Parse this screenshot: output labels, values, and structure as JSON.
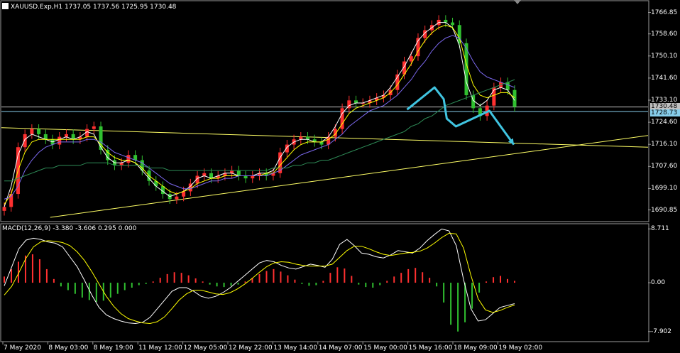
{
  "header": {
    "main_title": "XAUUSD.Exp,H1  1737.05 1737.56 1725.95 1730.48",
    "macd_title": "MACD(12,26,9) -3.380 -3.606 0.295 0.000"
  },
  "chart_data": [
    {
      "type": "candlestick",
      "title": "XAUUSD.Exp,H1  1737.05 1737.56 1725.95 1730.48",
      "symbol": "XAUUSD.Exp",
      "timeframe": "H1",
      "ohlc_last": {
        "open": 1737.05,
        "high": 1737.56,
        "low": 1725.95,
        "close": 1730.48
      },
      "ylim": [
        1688.0,
        1770.0
      ],
      "y_ticks": [
        "1766.85",
        "1758.60",
        "1750.10",
        "1741.60",
        "1733.10",
        "1724.60",
        "1716.10",
        "1707.60",
        "1699.10",
        "1690.85"
      ],
      "x_ticks": [
        "7 May 2020",
        "8 May 03:00",
        "8 May 19:00",
        "11 May 12:00",
        "12 May 05:00",
        "12 May 22:00",
        "13 May 14:00",
        "14 May 07:00",
        "15 May 00:00",
        "15 May 16:00",
        "18 May 09:00",
        "19 May 02:00"
      ],
      "price_tags": [
        {
          "value": "1730.48",
          "color": "#c0c0c0"
        },
        {
          "value": "1728.73",
          "color": "#87ceeb"
        }
      ],
      "horizontal_levels": [
        1730.48,
        1728.73
      ],
      "close_path": [
        1692,
        1697,
        1715,
        1720,
        1722,
        1720,
        1718,
        1716,
        1719,
        1720,
        1718,
        1719,
        1722,
        1723,
        1714,
        1710,
        1708,
        1709,
        1712,
        1710,
        1706,
        1702,
        1700,
        1697,
        1695,
        1696,
        1698,
        1701,
        1704,
        1705,
        1703,
        1704,
        1705,
        1706,
        1704,
        1703,
        1704,
        1705,
        1704,
        1705,
        1713,
        1716,
        1718,
        1719,
        1718,
        1717,
        1716,
        1719,
        1722,
        1730,
        1733,
        1732,
        1732,
        1733,
        1734,
        1735,
        1737,
        1743,
        1748,
        1750,
        1757,
        1760,
        1762,
        1764,
        1763,
        1762,
        1755,
        1735,
        1730,
        1727,
        1731,
        1738,
        1740,
        1737,
        1730.48
      ],
      "moving_averages": [
        {
          "color": "#ffffff",
          "values": [
            1692,
            1700,
            1712,
            1718,
            1720,
            1719,
            1718,
            1717,
            1718,
            1719,
            1718,
            1719,
            1721,
            1720,
            1715,
            1711,
            1709,
            1709,
            1710,
            1709,
            1706,
            1703,
            1700,
            1698,
            1696,
            1697,
            1698,
            1700,
            1703,
            1704,
            1703,
            1704,
            1705,
            1705,
            1704,
            1704,
            1704,
            1705,
            1705,
            1706,
            1711,
            1715,
            1717,
            1718,
            1718,
            1717,
            1717,
            1719,
            1723,
            1728,
            1731,
            1732,
            1732,
            1733,
            1734,
            1735,
            1738,
            1742,
            1746,
            1751,
            1756,
            1759,
            1761,
            1763,
            1763,
            1761,
            1754,
            1740,
            1733,
            1731,
            1733,
            1737,
            1738,
            1737,
            1733
          ]
        },
        {
          "color": "#ffff00",
          "values": [
            1693,
            1697,
            1706,
            1713,
            1717,
            1718,
            1718,
            1718,
            1718,
            1718,
            1718,
            1718,
            1719,
            1719,
            1716,
            1713,
            1711,
            1710,
            1710,
            1709,
            1707,
            1704,
            1702,
            1700,
            1698,
            1697,
            1698,
            1699,
            1701,
            1702,
            1703,
            1703,
            1704,
            1704,
            1704,
            1704,
            1704,
            1704,
            1705,
            1705,
            1708,
            1711,
            1714,
            1716,
            1717,
            1717,
            1717,
            1718,
            1720,
            1724,
            1728,
            1730,
            1731,
            1732,
            1733,
            1734,
            1736,
            1739,
            1743,
            1747,
            1752,
            1756,
            1759,
            1761,
            1762,
            1761,
            1757,
            1747,
            1739,
            1735,
            1734,
            1735,
            1736,
            1736,
            1734
          ]
        },
        {
          "color": "#7b68ee",
          "values": [
            1695,
            1696,
            1700,
            1706,
            1710,
            1713,
            1715,
            1716,
            1717,
            1717,
            1717,
            1717,
            1718,
            1718,
            1717,
            1715,
            1713,
            1712,
            1711,
            1710,
            1709,
            1707,
            1705,
            1703,
            1701,
            1700,
            1699,
            1699,
            1700,
            1701,
            1702,
            1702,
            1703,
            1703,
            1704,
            1704,
            1704,
            1704,
            1704,
            1705,
            1706,
            1708,
            1710,
            1712,
            1713,
            1714,
            1715,
            1716,
            1718,
            1720,
            1723,
            1725,
            1727,
            1729,
            1730,
            1731,
            1733,
            1735,
            1738,
            1741,
            1745,
            1748,
            1752,
            1755,
            1757,
            1758,
            1757,
            1753,
            1748,
            1744,
            1742,
            1741,
            1740,
            1739,
            1738
          ]
        },
        {
          "color": "#2e8b57",
          "values": [
            1702,
            1702,
            1703,
            1704,
            1705,
            1706,
            1707,
            1707,
            1708,
            1708,
            1708,
            1708,
            1709,
            1709,
            1709,
            1709,
            1708,
            1708,
            1708,
            1708,
            1708,
            1707,
            1707,
            1707,
            1706,
            1706,
            1706,
            1706,
            1706,
            1706,
            1706,
            1706,
            1706,
            1706,
            1706,
            1706,
            1706,
            1706,
            1706,
            1707,
            1707,
            1707,
            1708,
            1708,
            1709,
            1709,
            1710,
            1710,
            1711,
            1712,
            1713,
            1714,
            1715,
            1716,
            1717,
            1718,
            1719,
            1720,
            1721,
            1723,
            1724,
            1726,
            1727,
            1729,
            1731,
            1732,
            1733,
            1734,
            1735,
            1736,
            1737,
            1738,
            1739,
            1740,
            1741
          ]
        }
      ],
      "trendlines": [
        {
          "color": "#ffff66",
          "from": [
            0,
            1722.5
          ],
          "to": [
            106,
            1715.0
          ]
        },
        {
          "color": "#ffff66",
          "from": [
            8,
            1688.0
          ],
          "to": [
            106,
            1719.5
          ]
        }
      ],
      "forecast_arrows": {
        "color": "#40c4e0",
        "points": [
          [
            66.5,
            1729.5
          ],
          [
            71,
            1738.0
          ],
          [
            72.5,
            1733.5
          ],
          [
            73,
            1726.0
          ],
          [
            74.5,
            1723.0
          ],
          [
            80,
            1729.0
          ],
          [
            84,
            1716.0
          ]
        ]
      }
    },
    {
      "type": "bar+line",
      "title": "MACD(12,26,9) -3.380 -3.606 0.295 0.000",
      "indicator": "MACD",
      "params": [
        12,
        26,
        9
      ],
      "values_last": {
        "macd": -3.38,
        "signal": -3.606,
        "histogram": 0.295,
        "extra": 0.0
      },
      "ylim": [
        -8.5,
        9.2
      ],
      "y_ticks": [
        "8.711",
        "0.00",
        "-7.902"
      ],
      "histogram_positive_color": "#ff3030",
      "histogram_negative_color": "#30c030",
      "macd_line_color": "#ffffff",
      "signal_line_color": "#ffff00",
      "histogram": [
        1.0,
        2.2,
        3.4,
        4.4,
        4.6,
        3.8,
        2.2,
        0.6,
        -0.6,
        -1.2,
        -1.8,
        -2.4,
        -2.8,
        -3.1,
        -2.9,
        -2.4,
        -1.8,
        -1.2,
        -0.8,
        -0.4,
        -0.2,
        0.2,
        0.8,
        1.4,
        1.7,
        1.6,
        1.2,
        0.7,
        0.2,
        -0.3,
        -0.6,
        -0.7,
        -0.5,
        -0.3,
        0.2,
        0.8,
        1.4,
        1.9,
        2.2,
        1.8,
        1.2,
        0.5,
        -0.2,
        -0.5,
        -0.4,
        0.3,
        1.6,
        2.5,
        2.3,
        1.1,
        -0.3,
        -0.7,
        -0.8,
        -0.4,
        0.3,
        1.0,
        1.6,
        2.2,
        2.4,
        1.7,
        0.8,
        -0.6,
        -3.2,
        -6.8,
        -7.9,
        -6.4,
        -4.2,
        -1.6,
        0.2,
        0.9,
        1.1,
        0.6,
        0.295
      ],
      "macd_line": [
        -0.5,
        2.5,
        5.5,
        6.9,
        7.2,
        7.0,
        6.6,
        6.4,
        5.8,
        4.2,
        2.6,
        0.4,
        -2.0,
        -4.0,
        -5.2,
        -5.8,
        -6.2,
        -6.5,
        -6.6,
        -6.4,
        -5.6,
        -4.2,
        -2.8,
        -1.4,
        -0.8,
        -0.8,
        -1.4,
        -2.2,
        -2.5,
        -2.2,
        -1.6,
        -0.8,
        0.2,
        1.2,
        2.2,
        3.2,
        3.6,
        3.4,
        2.8,
        2.4,
        2.2,
        2.6,
        3.0,
        2.8,
        2.5,
        3.8,
        6.2,
        7.0,
        6.0,
        4.8,
        4.6,
        4.2,
        4.0,
        4.5,
        5.2,
        5.0,
        4.8,
        5.6,
        6.8,
        7.8,
        8.7,
        8.4,
        6.0,
        0.5,
        -4.2,
        -6.2,
        -6.0,
        -5.0,
        -4.0,
        -3.7,
        -3.38
      ],
      "signal_line": [
        -2.0,
        -0.6,
        1.6,
        4.0,
        5.8,
        6.6,
        6.8,
        6.7,
        6.5,
        6.0,
        5.0,
        3.6,
        1.8,
        -0.2,
        -2.2,
        -3.8,
        -5.0,
        -5.8,
        -6.2,
        -6.5,
        -6.6,
        -6.3,
        -5.5,
        -4.2,
        -2.8,
        -1.8,
        -1.2,
        -1.2,
        -1.5,
        -1.8,
        -1.9,
        -1.6,
        -1.0,
        -0.2,
        0.7,
        1.7,
        2.6,
        3.2,
        3.4,
        3.3,
        3.0,
        2.8,
        2.7,
        2.7,
        2.7,
        3.0,
        4.1,
        5.2,
        5.9,
        5.9,
        5.5,
        5.0,
        4.6,
        4.4,
        4.6,
        4.8,
        4.9,
        5.1,
        5.6,
        6.4,
        7.3,
        8.0,
        7.9,
        5.6,
        1.2,
        -2.6,
        -4.4,
        -4.8,
        -4.5,
        -4.0,
        -3.606
      ]
    }
  ]
}
